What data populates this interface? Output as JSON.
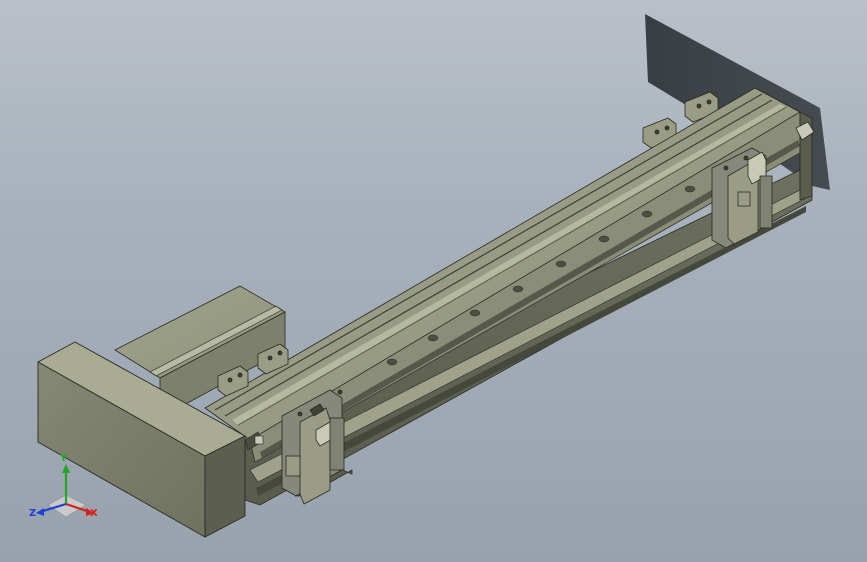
{
  "viewport": {
    "background_top": "#b9c0c9",
    "background_bottom": "#98a2ad"
  },
  "model": {
    "body_color": "#8c8f78",
    "dark_color": "#4f5245",
    "light_color": "#b3b59c",
    "edge_color": "#2a2b24"
  },
  "triad": {
    "x_label": "X",
    "y_label": "Y",
    "z_label": "Z",
    "x_color": "#d81e1e",
    "y_color": "#1fa81f",
    "z_color": "#1e3fd8"
  }
}
